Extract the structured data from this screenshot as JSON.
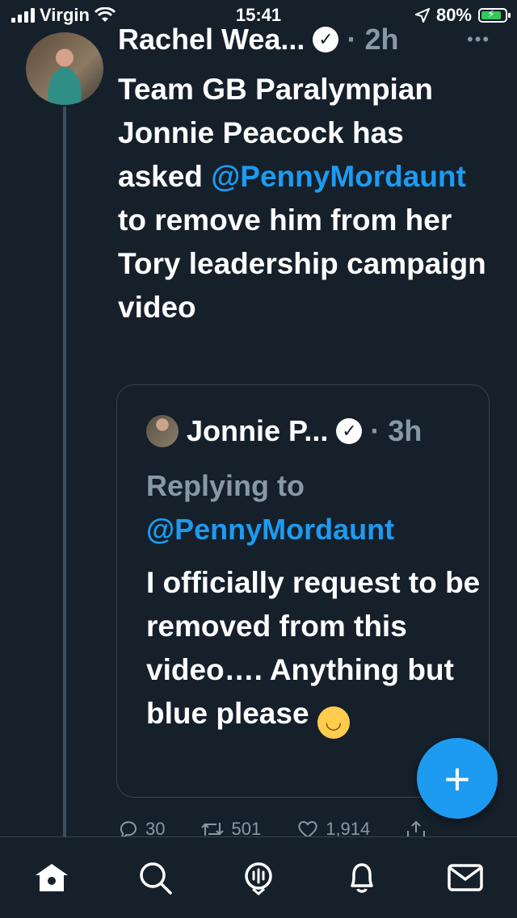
{
  "status_bar": {
    "carrier": "Virgin",
    "time": "15:41",
    "battery": "80%"
  },
  "tweet": {
    "author": "Rachel Wea...",
    "time": "2h",
    "text_before": "Team GB Paralympian Jonnie Peacock has asked ",
    "mention": "@PennyMordaunt",
    "text_after": " to remove him from her Tory leadership campaign video"
  },
  "quote": {
    "author": "Jonnie P...",
    "time": "3h",
    "replying_label": "Replying to",
    "replying_mention": "@PennyMordaunt",
    "text": "I officially request to be removed from this video…. Anything but blue please",
    "emoji_icon": "smiling-face-icon"
  },
  "actions": {
    "replies": "30",
    "retweets": "501",
    "likes": "1,914"
  },
  "fab": {
    "label": "+"
  },
  "tabbar": {
    "items": [
      "home-icon",
      "search-icon",
      "spaces-icon",
      "notifications-icon",
      "messages-icon"
    ]
  },
  "colors": {
    "background": "#15202b",
    "accent": "#1d9bf0",
    "muted": "#8899a6"
  }
}
